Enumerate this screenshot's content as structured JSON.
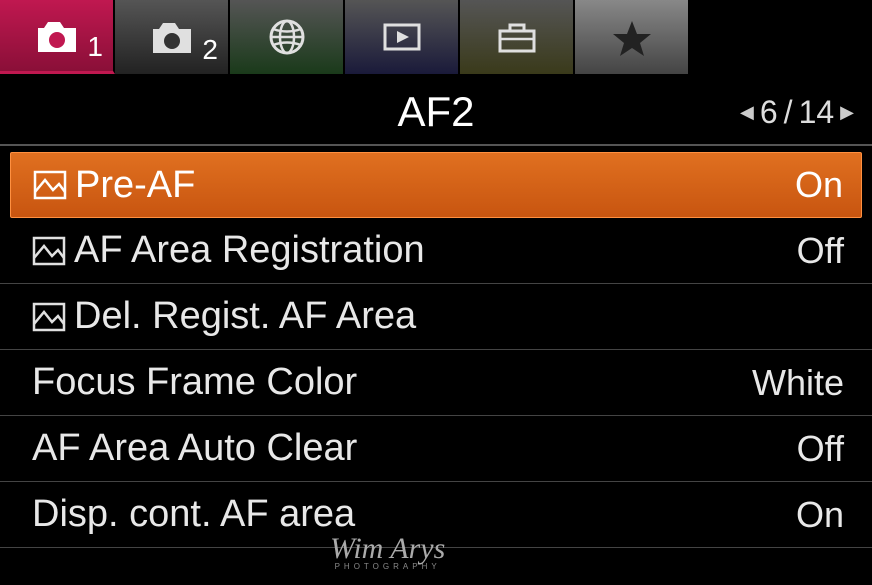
{
  "tabs": {
    "tab1_badge": "1",
    "tab2_badge": "2"
  },
  "header": {
    "title": "AF2",
    "page_current": "6",
    "page_total": "14"
  },
  "menu": {
    "items": [
      {
        "label": "Pre-AF",
        "value": "On",
        "has_icon": true,
        "selected": true
      },
      {
        "label": "AF Area Registration",
        "value": "Off",
        "has_icon": true,
        "selected": false
      },
      {
        "label": "Del. Regist. AF Area",
        "value": "",
        "has_icon": true,
        "selected": false
      },
      {
        "label": "Focus Frame Color",
        "value": "White",
        "has_icon": false,
        "selected": false
      },
      {
        "label": "AF Area Auto Clear",
        "value": "Off",
        "has_icon": false,
        "selected": false
      },
      {
        "label": "Disp. cont. AF area",
        "value": "On",
        "has_icon": false,
        "selected": false
      }
    ]
  },
  "watermark": {
    "text": "Wim Arys",
    "sub": "PHOTOGRAPHY"
  },
  "colors": {
    "accent_selected": "#d86018",
    "tab_active": "#c01850"
  }
}
